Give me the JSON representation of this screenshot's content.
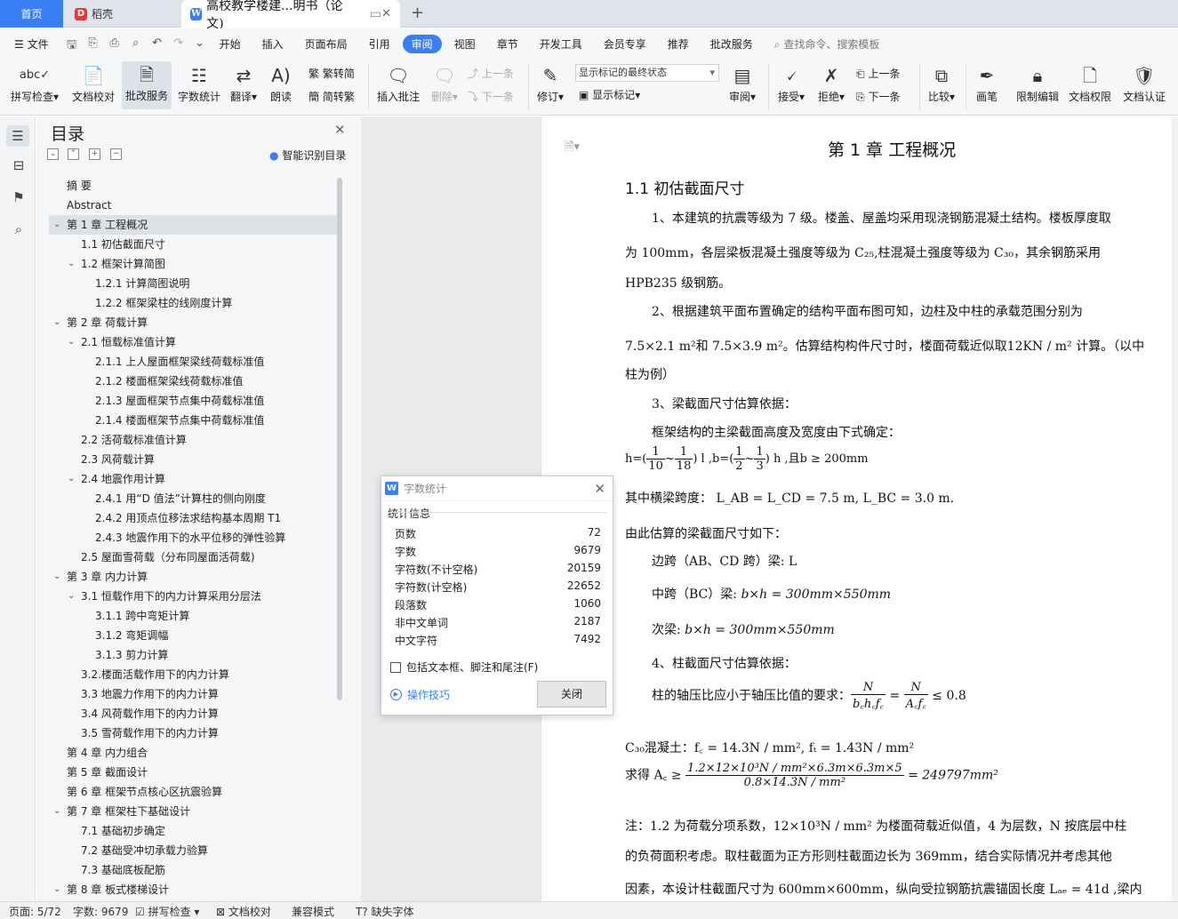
{
  "tabs": {
    "home": "首页",
    "daoke": "稻壳",
    "doc": "高校教学楼建...明书（论文)"
  },
  "menu": {
    "file": "文件",
    "items": [
      "开始",
      "插入",
      "页面布局",
      "引用",
      "审阅",
      "视图",
      "章节",
      "开发工具",
      "会员专享",
      "推荐",
      "批改服务"
    ],
    "active": "审阅",
    "search": "查找命令、搜索模板"
  },
  "ribbon": {
    "spell": "拼写检查",
    "proof": "文档校对",
    "grading": "批改服务",
    "wordcount": "字数统计",
    "translate": "翻译",
    "read": "朗读",
    "trad": "繁转简",
    "simp": "简转繁",
    "insert_comment": "插入批注",
    "delete": "删除",
    "prev": "上一条",
    "next": "下一条",
    "revise": "修订",
    "markup_select": "显示标记的最终状态",
    "show_markup": "显示标记",
    "review": "审阅",
    "accept": "接受",
    "reject": "拒绝",
    "prev2": "上一条",
    "next2": "下一条",
    "compare": "比较",
    "pen": "画笔",
    "restrict": "限制编辑",
    "doc_perm": "文档权限",
    "doc_cert": "文档认证"
  },
  "toc": {
    "title": "目录",
    "smart": "智能识别目录",
    "items": [
      {
        "text": "摘    要",
        "level": 0,
        "arrow": ""
      },
      {
        "text": "Abstract",
        "level": 0,
        "arrow": ""
      },
      {
        "text": "第 1 章  工程概况",
        "level": 0,
        "arrow": "v",
        "selected": true
      },
      {
        "text": "1.1  初估截面尺寸",
        "level": 1,
        "arrow": ""
      },
      {
        "text": "1.2  框架计算简图",
        "level": 1,
        "arrow": "v"
      },
      {
        "text": "1.2.1  计算简图说明",
        "level": 2,
        "arrow": ""
      },
      {
        "text": "1.2.2  框架梁柱的线刚度计算",
        "level": 2,
        "arrow": ""
      },
      {
        "text": "第 2 章  荷载计算",
        "level": 0,
        "arrow": "v"
      },
      {
        "text": "2.1  恒载标准值计算",
        "level": 1,
        "arrow": "v"
      },
      {
        "text": "2.1.1  上人屋面框架梁线荷载标准值",
        "level": 2,
        "arrow": ""
      },
      {
        "text": "2.1.2  楼面框架梁线荷载标准值",
        "level": 2,
        "arrow": ""
      },
      {
        "text": "2.1.3 屋面框架节点集中荷载标准值",
        "level": 2,
        "arrow": ""
      },
      {
        "text": "2.1.4 楼面框架节点集中荷载标准值",
        "level": 2,
        "arrow": ""
      },
      {
        "text": "2.2  活荷载标准值计算",
        "level": 1,
        "arrow": ""
      },
      {
        "text": "2.3  风荷载计算",
        "level": 1,
        "arrow": ""
      },
      {
        "text": "2.4 地震作用计算",
        "level": 1,
        "arrow": "v"
      },
      {
        "text": "2.4.1  用“D 值法”计算柱的侧向刚度",
        "level": 2,
        "arrow": ""
      },
      {
        "text": "2.4.2 用顶点位移法求结构基本周期 T1",
        "level": 2,
        "arrow": ""
      },
      {
        "text": "2.4.3  地震作用下的水平位移的弹性验算",
        "level": 2,
        "arrow": ""
      },
      {
        "text": "2.5  屋面雪荷载（分布同屋面活荷载)",
        "level": 1,
        "arrow": ""
      },
      {
        "text": "第 3 章  内力计算",
        "level": 0,
        "arrow": "v"
      },
      {
        "text": "3.1  恒载作用下的内力计算采用分层法",
        "level": 1,
        "arrow": "v"
      },
      {
        "text": "3.1.1 跨中弯矩计算",
        "level": 2,
        "arrow": ""
      },
      {
        "text": "3.1.2 弯矩调幅",
        "level": 2,
        "arrow": ""
      },
      {
        "text": "3.1.3  剪力计算",
        "level": 2,
        "arrow": ""
      },
      {
        "text": "3.2.楼面活载作用下的内力计算",
        "level": 1,
        "arrow": ""
      },
      {
        "text": "3.3  地震力作用下的内力计算",
        "level": 1,
        "arrow": ""
      },
      {
        "text": "3.4  风荷载作用下的内力计算",
        "level": 1,
        "arrow": ""
      },
      {
        "text": "3.5 雪荷载作用下的内力计算",
        "level": 1,
        "arrow": ""
      },
      {
        "text": "第 4 章  内力组合",
        "level": 0,
        "arrow": ""
      },
      {
        "text": "第 5 章    截面设计",
        "level": 0,
        "arrow": ""
      },
      {
        "text": "第 6 章  框架节点核心区抗震验算",
        "level": 0,
        "arrow": ""
      },
      {
        "text": "第 7 章  框架柱下基础设计",
        "level": 0,
        "arrow": "v"
      },
      {
        "text": "7.1  基础初步确定",
        "level": 1,
        "arrow": ""
      },
      {
        "text": "7.2 基础受冲切承载力验算",
        "level": 1,
        "arrow": ""
      },
      {
        "text": "7.3  基础底板配筋",
        "level": 1,
        "arrow": ""
      },
      {
        "text": "第 8 章  板式楼梯设计",
        "level": 0,
        "arrow": "v"
      }
    ]
  },
  "dialog": {
    "title": "字数统计",
    "section": "统计信息",
    "stats": [
      {
        "label": "页数",
        "value": "72"
      },
      {
        "label": "字数",
        "value": "9679"
      },
      {
        "label": "字符数(不计空格)",
        "value": "20159"
      },
      {
        "label": "字符数(计空格)",
        "value": "22652"
      },
      {
        "label": "段落数",
        "value": "1060"
      },
      {
        "label": "非中文单词",
        "value": "2187"
      },
      {
        "label": "中文字符",
        "value": "7492"
      }
    ],
    "include": "包括文本框、脚注和尾注(F)",
    "tips": "操作技巧",
    "close": "关闭"
  },
  "doc": {
    "chapter": "第 1 章  工程概况",
    "section": "1.1  初估截面尺寸",
    "p1a": "1、本建筑的抗震等级为 7 级。楼盖、屋盖均采用现浇钢筋混凝土结构。楼板厚度取",
    "p1b": "为 100mm，各层梁板混凝土强度等级为 C₂₅,柱混凝土强度等级为 C₃₀，其余钢筋采用",
    "p1c": "HPB235 级钢筋。",
    "p2a": "2、根据建筑平面布置确定的结构平面布图可知，边柱及中柱的承载范围分别为",
    "p2b": "7.5×2.1 m²和 7.5×3.9 m²。估算结构构件尺寸时，楼面荷载近似取12KN / m² 计算。（以中",
    "p2c": "柱为例）",
    "p3": "3、梁截面尺寸估算依据：",
    "p4": "框架结构的主梁截面高度及宽度由下式确定：",
    "f1a": "h",
    "f1b": "=(",
    "f1c": "1",
    "f1d": "10",
    "f1e": "~",
    "f1f": "1",
    "f1g": "18",
    "f1h": ") l",
    "f1i": " ,b",
    "f1j": "=(",
    "f1k": "1",
    "f1l": "2",
    "f1m": "~",
    "f1n": "1",
    "f1o": "3",
    "f1p": ")  h",
    "f1q": " ,且b",
    "f1r": " ≥ 200mm",
    "p5": "其中横梁跨度：  L_AB = L_CD = 7.5 m, L_BC = 3.0 m.",
    "p6": "由此估算的梁截面尺寸如下：",
    "p7": "边跨（AB、CD 跨）梁: L",
    "p8a": "中跨（BC）梁:  ",
    "p8b": "b×h = 300mm×550mm",
    "p9a": "次梁:  ",
    "p9b": "b×h = 300mm×550mm",
    "p10": "4、柱截面尺寸估算依据：",
    "p11": "柱的轴压比应小于轴压比值的要求：",
    "f2n": "N",
    "f2d": "b꜀h꜀f꜀",
    "f2eq": " = ",
    "f2n2": "N",
    "f2d2": "A꜀f꜀",
    "f2le": " ≤ 0.8",
    "p12": "C₃₀混凝土：f꜀ = 14.3N / mm², fₜ = 1.43N / mm²",
    "p13a": "求得  A꜀ ≥ ",
    "p13n": "1.2×12×10³N / mm²×6.3m×6.3m×5",
    "p13d": "0.8×14.3N / mm²",
    "p13r": " = 249797mm²",
    "p14a": "注：1.2 为荷载分项系数，12×10³N / mm² 为楼面荷载近似值，4 为层数，N 按底层中柱",
    "p14b": "的负荷面积考虑。取柱截面为正方形则柱截面边长为 369mm，结合实际情况并考虑其他",
    "p14c": "因素，本设计柱截面尺寸为 600mm×600mm，纵向受拉钢筋抗震锚固长度 Lₐₑ = 41d ,梁内"
  },
  "status": {
    "page": "页面: 5/72",
    "words": "字数: 9679",
    "spell": "拼写检查",
    "proof": "文档校对",
    "compat": "兼容模式",
    "missing_font": "缺失字体"
  },
  "colors": {
    "accent": "#3a7ef6",
    "tabbar": "#dfe3ea",
    "ribbon": "#f6f7f9"
  }
}
